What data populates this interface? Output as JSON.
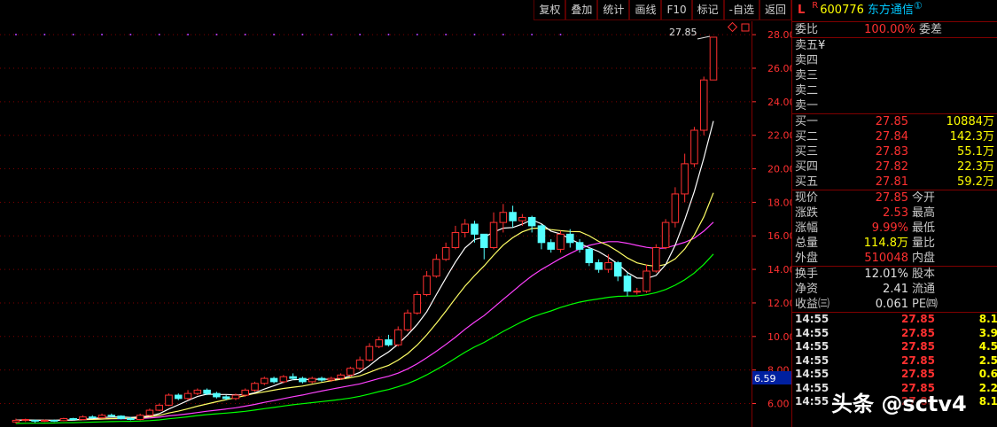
{
  "toolbar": {
    "buttons": [
      "复权",
      "叠加",
      "统计",
      "画线",
      "F10",
      "标记",
      "-自选",
      "返回"
    ]
  },
  "header": {
    "prefix": "L",
    "flag": "R",
    "code": "600776",
    "name": "东方通信",
    "circle": "①"
  },
  "weibi": {
    "label": "委比",
    "value": "100.00%",
    "label2": "委差"
  },
  "sell": [
    {
      "label": "卖五",
      "mark": "¥"
    },
    {
      "label": "卖四"
    },
    {
      "label": "卖三"
    },
    {
      "label": "卖二"
    },
    {
      "label": "卖一"
    }
  ],
  "buy": [
    {
      "label": "买一",
      "price": "27.85",
      "vol": "10884万"
    },
    {
      "label": "买二",
      "price": "27.84",
      "vol": "142.3万"
    },
    {
      "label": "买三",
      "price": "27.83",
      "vol": "55.1万"
    },
    {
      "label": "买四",
      "price": "27.82",
      "vol": "22.3万"
    },
    {
      "label": "买五",
      "price": "27.81",
      "vol": "59.2万"
    }
  ],
  "quote": [
    {
      "label": "现价",
      "value": "27.85",
      "label2": "今开"
    },
    {
      "label": "涨跌",
      "value": "2.53",
      "label2": "最高"
    },
    {
      "label": "涨幅",
      "value": "9.99%",
      "label2": "最低"
    },
    {
      "label": "总量",
      "value": "114.8万",
      "label2": "量比"
    },
    {
      "label": "外盘",
      "value": "510048",
      "label2": "内盘"
    }
  ],
  "stats": [
    {
      "label": "换手",
      "value": "12.01%",
      "label2": "股本"
    },
    {
      "label": "净资",
      "value": "2.41",
      "label2": "流通"
    },
    {
      "label": "收益㈢",
      "value": "0.061",
      "label2": "PE㈣"
    }
  ],
  "ticks": [
    {
      "time": "14:55",
      "price": "27.85",
      "vol": "8.1"
    },
    {
      "time": "14:55",
      "price": "27.85",
      "vol": "3.9"
    },
    {
      "time": "14:55",
      "price": "27.85",
      "vol": "4.5"
    },
    {
      "time": "14:55",
      "price": "27.85",
      "vol": "2.5"
    },
    {
      "time": "14:55",
      "price": "27.85",
      "vol": "0.6"
    },
    {
      "time": "14:55",
      "price": "27.85",
      "vol": "2.2"
    },
    {
      "time": "14:55",
      "price": "27.85",
      "vol": "8.1"
    }
  ],
  "watermark": "头条 @sctv4",
  "colors": {
    "up": "#ff3030",
    "down": "#54ffff",
    "ma5": "#ffffff",
    "ma10": "#ffff66",
    "ma20": "#ff40ff",
    "ma60": "#00ff00",
    "grid": "#800000"
  },
  "chart_data": {
    "type": "candlestick",
    "y_ticks": [
      "28.00",
      "26.00",
      "24.00",
      "22.00",
      "20.00",
      "18.00",
      "16.00",
      "14.00",
      "12.00",
      "10.00",
      "8.00",
      "6.00"
    ],
    "ylim": [
      4.6,
      28.8
    ],
    "last_price_label": "27.85",
    "current_marker": "6.59",
    "candles": [
      [
        4.9,
        5.0,
        4.8,
        5.1
      ],
      [
        5.0,
        5.05,
        4.9,
        5.1
      ],
      [
        5.0,
        4.95,
        4.85,
        5.05
      ],
      [
        4.95,
        5.0,
        4.9,
        5.05
      ],
      [
        5.0,
        4.98,
        4.9,
        5.05
      ],
      [
        4.98,
        5.1,
        4.95,
        5.15
      ],
      [
        5.1,
        5.05,
        5.0,
        5.15
      ],
      [
        5.05,
        5.2,
        5.0,
        5.3
      ],
      [
        5.2,
        5.15,
        5.1,
        5.3
      ],
      [
        5.15,
        5.3,
        5.1,
        5.4
      ],
      [
        5.3,
        5.25,
        5.2,
        5.4
      ],
      [
        5.25,
        5.1,
        5.05,
        5.3
      ],
      [
        5.1,
        5.05,
        5.0,
        5.2
      ],
      [
        5.05,
        5.3,
        5.0,
        5.4
      ],
      [
        5.3,
        5.6,
        5.25,
        5.7
      ],
      [
        5.6,
        5.9,
        5.55,
        6.0
      ],
      [
        5.9,
        6.5,
        5.85,
        6.6
      ],
      [
        6.5,
        6.3,
        6.2,
        6.6
      ],
      [
        6.3,
        6.6,
        6.2,
        6.8
      ],
      [
        6.6,
        6.8,
        6.5,
        6.9
      ],
      [
        6.8,
        6.6,
        6.5,
        6.9
      ],
      [
        6.6,
        6.4,
        6.3,
        6.7
      ],
      [
        6.4,
        6.3,
        6.2,
        6.5
      ],
      [
        6.3,
        6.5,
        6.2,
        6.6
      ],
      [
        6.5,
        6.8,
        6.4,
        6.9
      ],
      [
        6.8,
        7.2,
        6.7,
        7.3
      ],
      [
        7.2,
        7.5,
        7.1,
        7.6
      ],
      [
        7.5,
        7.3,
        7.2,
        7.6
      ],
      [
        7.3,
        7.6,
        7.2,
        7.7
      ],
      [
        7.6,
        7.5,
        7.4,
        7.8
      ],
      [
        7.5,
        7.3,
        7.2,
        7.6
      ],
      [
        7.3,
        7.5,
        7.2,
        7.6
      ],
      [
        7.5,
        7.4,
        7.3,
        7.6
      ],
      [
        7.4,
        7.5,
        7.3,
        7.6
      ],
      [
        7.5,
        7.7,
        7.4,
        7.8
      ],
      [
        7.7,
        8.1,
        7.6,
        8.2
      ],
      [
        8.1,
        8.6,
        8.0,
        8.8
      ],
      [
        8.6,
        9.4,
        8.5,
        9.6
      ],
      [
        9.4,
        9.8,
        9.3,
        10.0
      ],
      [
        9.8,
        9.5,
        9.4,
        10.1
      ],
      [
        9.5,
        10.4,
        9.4,
        10.6
      ],
      [
        10.4,
        11.4,
        10.3,
        11.6
      ],
      [
        11.4,
        12.5,
        11.3,
        12.7
      ],
      [
        12.5,
        13.6,
        12.4,
        13.9
      ],
      [
        13.6,
        14.6,
        13.5,
        14.9
      ],
      [
        14.6,
        15.3,
        14.5,
        15.6
      ],
      [
        15.3,
        16.2,
        15.2,
        16.6
      ],
      [
        16.2,
        16.7,
        15.9,
        17.0
      ],
      [
        16.7,
        16.1,
        15.6,
        16.9
      ],
      [
        16.1,
        15.3,
        14.6,
        15.5
      ],
      [
        15.3,
        16.8,
        15.2,
        17.4
      ],
      [
        16.8,
        17.4,
        16.2,
        17.9
      ],
      [
        17.4,
        16.9,
        16.5,
        17.8
      ],
      [
        16.9,
        17.1,
        16.6,
        17.3
      ],
      [
        17.1,
        16.6,
        16.2,
        17.2
      ],
      [
        16.6,
        15.6,
        15.2,
        16.7
      ],
      [
        15.6,
        15.2,
        15.0,
        15.8
      ],
      [
        15.2,
        16.1,
        15.0,
        16.3
      ],
      [
        16.1,
        15.6,
        15.3,
        16.4
      ],
      [
        15.6,
        15.2,
        15.0,
        15.8
      ],
      [
        15.2,
        14.4,
        14.2,
        15.3
      ],
      [
        14.4,
        14.0,
        13.8,
        14.6
      ],
      [
        14.0,
        14.4,
        13.8,
        14.9
      ],
      [
        14.4,
        13.6,
        13.3,
        14.5
      ],
      [
        13.6,
        12.7,
        12.4,
        13.8
      ],
      [
        12.7,
        12.7,
        12.5,
        12.9
      ],
      [
        12.7,
        13.9,
        12.6,
        14.3
      ],
      [
        13.9,
        15.3,
        13.8,
        15.5
      ],
      [
        15.3,
        16.8,
        15.2,
        17.0
      ],
      [
        16.8,
        18.5,
        16.5,
        18.9
      ],
      [
        18.5,
        20.3,
        18.0,
        20.9
      ],
      [
        20.3,
        22.3,
        20.1,
        22.5
      ],
      [
        22.3,
        25.3,
        22.0,
        25.5
      ],
      [
        25.3,
        27.85,
        25.3,
        27.85
      ]
    ]
  }
}
